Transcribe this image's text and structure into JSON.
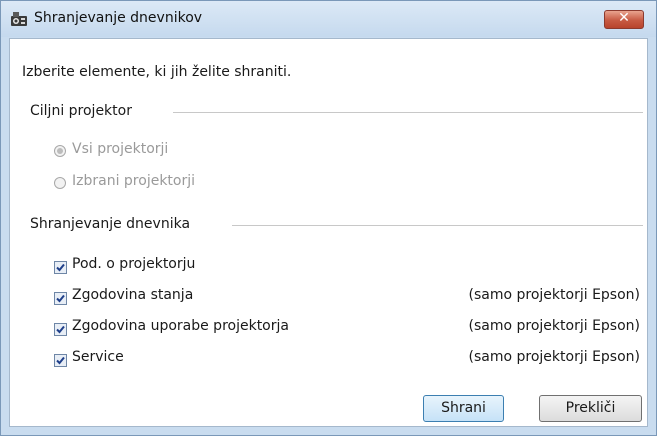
{
  "window": {
    "title": "Shranjevanje dnevnikov",
    "close_label": "✕"
  },
  "instruction": "Izberite elemente, ki jih želite shraniti.",
  "target_group": {
    "label": "Ciljni projektor",
    "options": [
      {
        "label": "Vsi projektorji",
        "selected": true,
        "enabled": false
      },
      {
        "label": "Izbrani projektorji",
        "selected": false,
        "enabled": false
      }
    ]
  },
  "log_group": {
    "label": "Shranjevanje dnevnika",
    "items": [
      {
        "label": "Pod. o projektorju",
        "checked": true,
        "note": ""
      },
      {
        "label": "Zgodovina stanja",
        "checked": true,
        "note": "(samo projektorji Epson)"
      },
      {
        "label": "Zgodovina uporabe projektorja",
        "checked": true,
        "note": "(samo projektorji Epson)"
      },
      {
        "label": "Service",
        "checked": true,
        "note": "(samo projektorji Epson)"
      }
    ]
  },
  "buttons": {
    "save": "Shrani",
    "cancel": "Prekliči"
  }
}
